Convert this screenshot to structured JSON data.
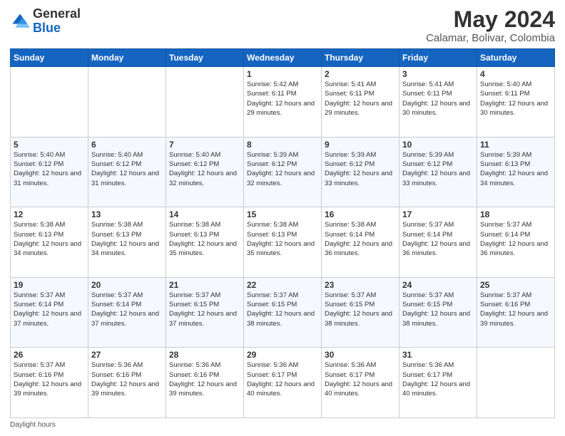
{
  "header": {
    "logo_general": "General",
    "logo_blue": "Blue",
    "main_title": "May 2024",
    "subtitle": "Calamar, Bolivar, Colombia"
  },
  "days_of_week": [
    "Sunday",
    "Monday",
    "Tuesday",
    "Wednesday",
    "Thursday",
    "Friday",
    "Saturday"
  ],
  "weeks": [
    [
      {
        "day": "",
        "info": ""
      },
      {
        "day": "",
        "info": ""
      },
      {
        "day": "",
        "info": ""
      },
      {
        "day": "1",
        "info": "Sunrise: 5:42 AM\nSunset: 6:11 PM\nDaylight: 12 hours and 29 minutes."
      },
      {
        "day": "2",
        "info": "Sunrise: 5:41 AM\nSunset: 6:11 PM\nDaylight: 12 hours and 29 minutes."
      },
      {
        "day": "3",
        "info": "Sunrise: 5:41 AM\nSunset: 6:11 PM\nDaylight: 12 hours and 30 minutes."
      },
      {
        "day": "4",
        "info": "Sunrise: 5:40 AM\nSunset: 6:11 PM\nDaylight: 12 hours and 30 minutes."
      }
    ],
    [
      {
        "day": "5",
        "info": "Sunrise: 5:40 AM\nSunset: 6:12 PM\nDaylight: 12 hours and 31 minutes."
      },
      {
        "day": "6",
        "info": "Sunrise: 5:40 AM\nSunset: 6:12 PM\nDaylight: 12 hours and 31 minutes."
      },
      {
        "day": "7",
        "info": "Sunrise: 5:40 AM\nSunset: 6:12 PM\nDaylight: 12 hours and 32 minutes."
      },
      {
        "day": "8",
        "info": "Sunrise: 5:39 AM\nSunset: 6:12 PM\nDaylight: 12 hours and 32 minutes."
      },
      {
        "day": "9",
        "info": "Sunrise: 5:39 AM\nSunset: 6:12 PM\nDaylight: 12 hours and 33 minutes."
      },
      {
        "day": "10",
        "info": "Sunrise: 5:39 AM\nSunset: 6:12 PM\nDaylight: 12 hours and 33 minutes."
      },
      {
        "day": "11",
        "info": "Sunrise: 5:39 AM\nSunset: 6:13 PM\nDaylight: 12 hours and 34 minutes."
      }
    ],
    [
      {
        "day": "12",
        "info": "Sunrise: 5:38 AM\nSunset: 6:13 PM\nDaylight: 12 hours and 34 minutes."
      },
      {
        "day": "13",
        "info": "Sunrise: 5:38 AM\nSunset: 6:13 PM\nDaylight: 12 hours and 34 minutes."
      },
      {
        "day": "14",
        "info": "Sunrise: 5:38 AM\nSunset: 6:13 PM\nDaylight: 12 hours and 35 minutes."
      },
      {
        "day": "15",
        "info": "Sunrise: 5:38 AM\nSunset: 6:13 PM\nDaylight: 12 hours and 35 minutes."
      },
      {
        "day": "16",
        "info": "Sunrise: 5:38 AM\nSunset: 6:14 PM\nDaylight: 12 hours and 36 minutes."
      },
      {
        "day": "17",
        "info": "Sunrise: 5:37 AM\nSunset: 6:14 PM\nDaylight: 12 hours and 36 minutes."
      },
      {
        "day": "18",
        "info": "Sunrise: 5:37 AM\nSunset: 6:14 PM\nDaylight: 12 hours and 36 minutes."
      }
    ],
    [
      {
        "day": "19",
        "info": "Sunrise: 5:37 AM\nSunset: 6:14 PM\nDaylight: 12 hours and 37 minutes."
      },
      {
        "day": "20",
        "info": "Sunrise: 5:37 AM\nSunset: 6:14 PM\nDaylight: 12 hours and 37 minutes."
      },
      {
        "day": "21",
        "info": "Sunrise: 5:37 AM\nSunset: 6:15 PM\nDaylight: 12 hours and 37 minutes."
      },
      {
        "day": "22",
        "info": "Sunrise: 5:37 AM\nSunset: 6:15 PM\nDaylight: 12 hours and 38 minutes."
      },
      {
        "day": "23",
        "info": "Sunrise: 5:37 AM\nSunset: 6:15 PM\nDaylight: 12 hours and 38 minutes."
      },
      {
        "day": "24",
        "info": "Sunrise: 5:37 AM\nSunset: 6:15 PM\nDaylight: 12 hours and 38 minutes."
      },
      {
        "day": "25",
        "info": "Sunrise: 5:37 AM\nSunset: 6:16 PM\nDaylight: 12 hours and 39 minutes."
      }
    ],
    [
      {
        "day": "26",
        "info": "Sunrise: 5:37 AM\nSunset: 6:16 PM\nDaylight: 12 hours and 39 minutes."
      },
      {
        "day": "27",
        "info": "Sunrise: 5:36 AM\nSunset: 6:16 PM\nDaylight: 12 hours and 39 minutes."
      },
      {
        "day": "28",
        "info": "Sunrise: 5:36 AM\nSunset: 6:16 PM\nDaylight: 12 hours and 39 minutes."
      },
      {
        "day": "29",
        "info": "Sunrise: 5:36 AM\nSunset: 6:17 PM\nDaylight: 12 hours and 40 minutes."
      },
      {
        "day": "30",
        "info": "Sunrise: 5:36 AM\nSunset: 6:17 PM\nDaylight: 12 hours and 40 minutes."
      },
      {
        "day": "31",
        "info": "Sunrise: 5:36 AM\nSunset: 6:17 PM\nDaylight: 12 hours and 40 minutes."
      },
      {
        "day": "",
        "info": ""
      }
    ]
  ],
  "footer": {
    "daylight_label": "Daylight hours"
  }
}
